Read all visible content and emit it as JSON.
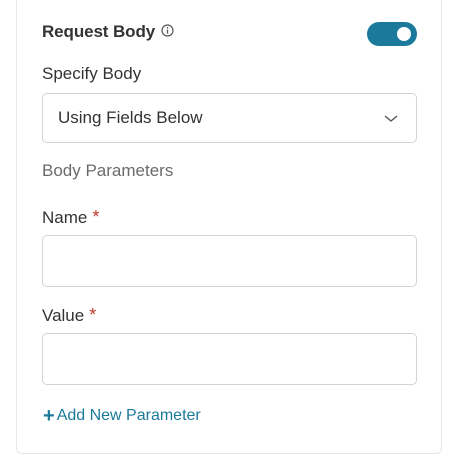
{
  "section": {
    "title": "Request Body",
    "info_icon": "info-circle-icon",
    "toggle_on": true,
    "accent_color": "#1b7a9c"
  },
  "specify_body": {
    "label": "Specify Body",
    "selected": "Using Fields Below",
    "chevron_icon": "chevron-down-icon"
  },
  "body_parameters": {
    "heading": "Body Parameters",
    "name_label": "Name",
    "name_required": "*",
    "name_value": "",
    "value_label": "Value",
    "value_required": "*",
    "value_value": "",
    "add_plus": "+",
    "add_label": "Add New Parameter"
  }
}
